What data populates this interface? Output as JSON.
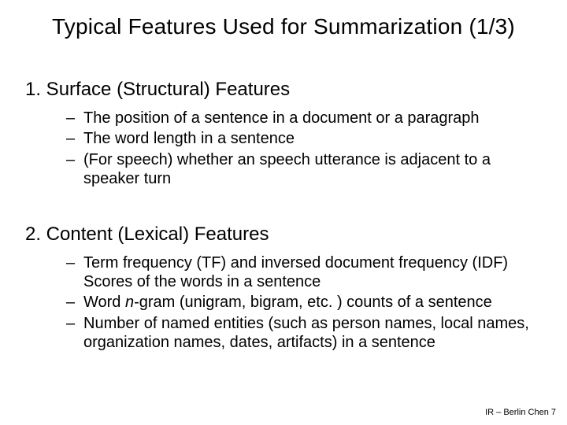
{
  "title": "Typical Features Used for Summarization (1/3)",
  "sections": [
    {
      "heading": "1. Surface (Structural) Features",
      "bullets": [
        "The position of a sentence in a document or a paragraph",
        "The word length in a sentence",
        "(For speech) whether an speech utterance is adjacent to a speaker turn"
      ]
    },
    {
      "heading": "2. Content (Lexical) Features",
      "bullets": [
        "Term frequency (TF) and inversed document frequency (IDF) Scores of the words in a sentence",
        "",
        "Number of named entities (such as person names, local names, organization names, dates, artifacts) in a sentence"
      ]
    }
  ],
  "section2_bullet2_prefix": "Word ",
  "section2_bullet2_italic": "n",
  "section2_bullet2_suffix": "-gram (unigram, bigram, etc. ) counts of a sentence",
  "footer": "IR – Berlin Chen 7"
}
